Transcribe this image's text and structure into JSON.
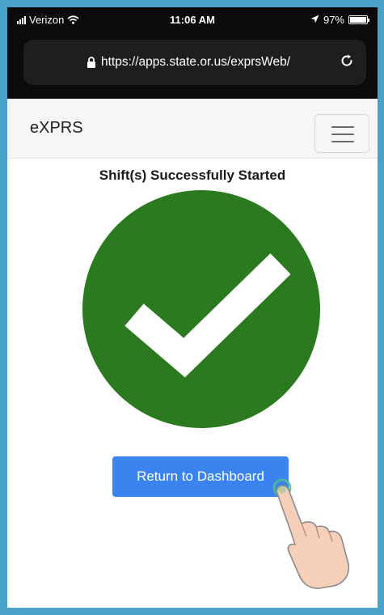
{
  "status_bar": {
    "carrier": "Verizon",
    "time": "11:06 AM",
    "battery": "97%"
  },
  "browser": {
    "url": "https://apps.state.or.us/exprsWeb/"
  },
  "navbar": {
    "brand": "eXPRS"
  },
  "main": {
    "title": "Shift(s) Successfully Started",
    "return_button_label": "Return to Dashboard"
  },
  "colors": {
    "success_green": "#2b7a1f",
    "button_blue": "#3b84f0"
  },
  "icons": [
    "signal-icon",
    "wifi-icon",
    "location-arrow-icon",
    "battery-icon",
    "lock-icon",
    "reload-icon",
    "hamburger-menu-icon",
    "checkmark-icon",
    "pointing-hand-icon"
  ]
}
